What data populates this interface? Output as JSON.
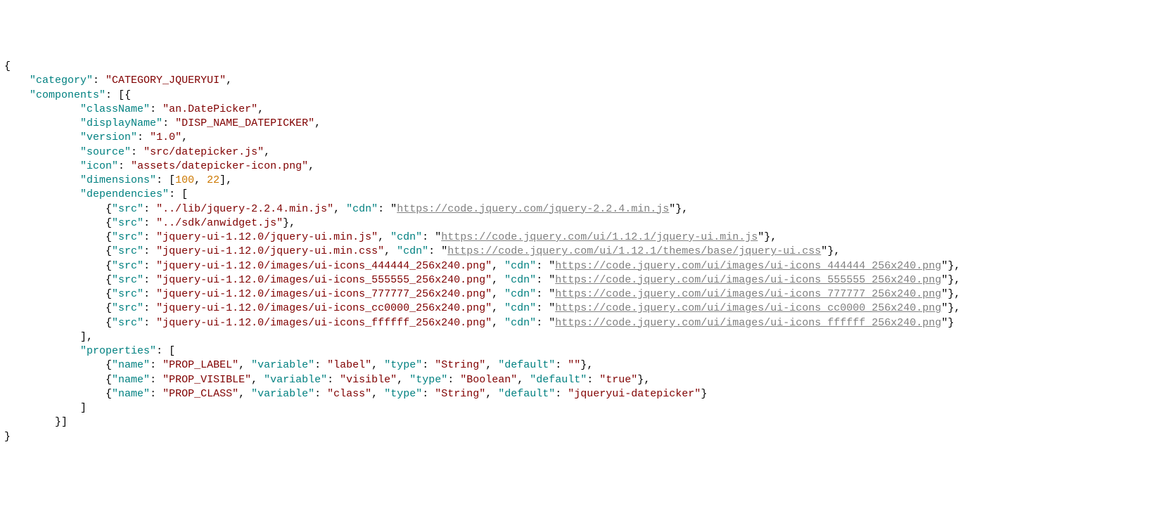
{
  "obj": {
    "category_key": "category",
    "category_val": "CATEGORY_JQUERYUI",
    "components_key": "components",
    "component": {
      "className": {
        "k": "className",
        "v": "an.DatePicker"
      },
      "displayName": {
        "k": "displayName",
        "v": "DISP_NAME_DATEPICKER"
      },
      "version": {
        "k": "version",
        "v": "1.0"
      },
      "source": {
        "k": "source",
        "v": "src/datepicker.js"
      },
      "icon": {
        "k": "icon",
        "v": "assets/datepicker-icon.png"
      },
      "dimensions": {
        "k": "dimensions",
        "w": "100",
        "h": "22"
      },
      "dependencies_key": "dependencies",
      "dependencies": [
        {
          "src": "../lib/jquery-2.2.4.min.js",
          "cdn": "https://code.jquery.com/jquery-2.2.4.min.js"
        },
        {
          "src": "../sdk/anwidget.js"
        },
        {
          "src": "jquery-ui-1.12.0/jquery-ui.min.js",
          "cdn": "https://code.jquery.com/ui/1.12.1/jquery-ui.min.js"
        },
        {
          "src": "jquery-ui-1.12.0/jquery-ui.min.css",
          "cdn": "https://code.jquery.com/ui/1.12.1/themes/base/jquery-ui.css"
        },
        {
          "src": "jquery-ui-1.12.0/images/ui-icons_444444_256x240.png",
          "cdn": "https://code.jquery.com/ui/images/ui-icons_444444_256x240.png"
        },
        {
          "src": "jquery-ui-1.12.0/images/ui-icons_555555_256x240.png",
          "cdn": "https://code.jquery.com/ui/images/ui-icons_555555_256x240.png"
        },
        {
          "src": "jquery-ui-1.12.0/images/ui-icons_777777_256x240.png",
          "cdn": "https://code.jquery.com/ui/images/ui-icons_777777_256x240.png"
        },
        {
          "src": "jquery-ui-1.12.0/images/ui-icons_cc0000_256x240.png",
          "cdn": "https://code.jquery.com/ui/images/ui-icons_cc0000_256x240.png"
        },
        {
          "src": "jquery-ui-1.12.0/images/ui-icons_ffffff_256x240.png",
          "cdn": "https://code.jquery.com/ui/images/ui-icons_ffffff_256x240.png"
        }
      ],
      "properties_key": "properties",
      "properties": [
        {
          "name": "PROP_LABEL",
          "variable": "label",
          "type": "String",
          "default": ""
        },
        {
          "name": "PROP_VISIBLE",
          "variable": "visible",
          "type": "Boolean",
          "default": "true"
        },
        {
          "name": "PROP_CLASS",
          "variable": "class",
          "type": "String",
          "default": "jqueryui-datepicker"
        }
      ]
    },
    "labels": {
      "src": "src",
      "cdn": "cdn",
      "name": "name",
      "variable": "variable",
      "type": "type",
      "default": "default"
    }
  }
}
